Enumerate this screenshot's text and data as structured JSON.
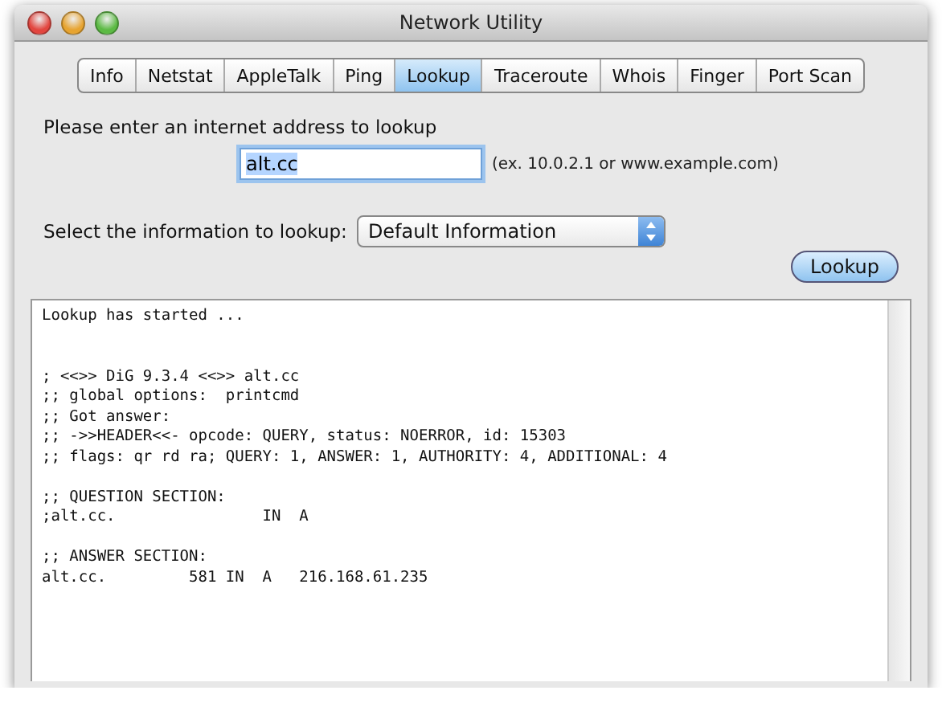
{
  "window": {
    "title": "Network Utility"
  },
  "tabs": [
    {
      "label": "Info",
      "selected": false
    },
    {
      "label": "Netstat",
      "selected": false
    },
    {
      "label": "AppleTalk",
      "selected": false
    },
    {
      "label": "Ping",
      "selected": false
    },
    {
      "label": "Lookup",
      "selected": true
    },
    {
      "label": "Traceroute",
      "selected": false
    },
    {
      "label": "Whois",
      "selected": false
    },
    {
      "label": "Finger",
      "selected": false
    },
    {
      "label": "Port Scan",
      "selected": false
    }
  ],
  "address": {
    "label": "Please enter an internet address to lookup",
    "value": "alt.cc",
    "hint": "(ex. 10.0.2.1 or www.example.com)"
  },
  "info": {
    "label": "Select the information to lookup:",
    "value": "Default Information"
  },
  "button": "Lookup",
  "output": [
    {
      "lines": [
        "Lookup has started ..."
      ]
    },
    {
      "lines": [
        "; <<>> DiG 9.3.4 <<>> alt.cc",
        ";; global options:  printcmd",
        ";; Got answer:",
        ";; ->>HEADER<<- opcode: QUERY, status: NOERROR, id: 15303",
        ";; flags: qr rd ra; QUERY: 1, ANSWER: 1, AUTHORITY: 4, ADDITIONAL: 4"
      ]
    },
    {
      "lines": [
        ";; QUESTION SECTION:",
        ";alt.cc.                IN  A"
      ]
    },
    {
      "lines": [
        ";; ANSWER SECTION:",
        "alt.cc.         581 IN  A   216.168.61.235"
      ]
    }
  ]
}
